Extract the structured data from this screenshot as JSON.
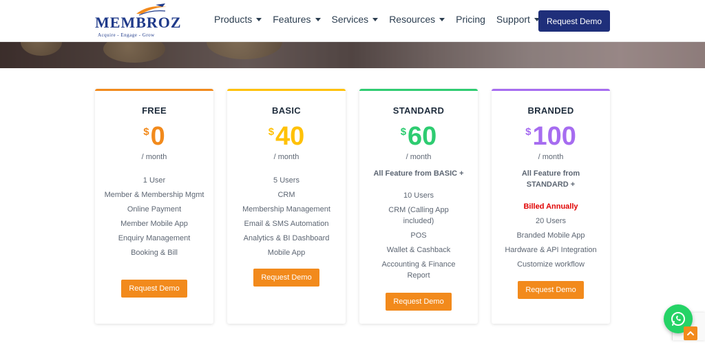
{
  "logo": {
    "word": "MEMBROZ",
    "tagline": "Acquire - Engage - Grow"
  },
  "nav": [
    {
      "label": "Products",
      "dropdown": true
    },
    {
      "label": "Features",
      "dropdown": true
    },
    {
      "label": "Services",
      "dropdown": true
    },
    {
      "label": "Resources",
      "dropdown": true
    },
    {
      "label": "Pricing",
      "dropdown": false
    },
    {
      "label": "Support",
      "dropdown": true
    }
  ],
  "header_button": "Request Demo",
  "colors": {
    "free": "#f28a1c",
    "basic": "#ffc107",
    "standard": "#2ecc71",
    "branded": "#a66cf0",
    "cta": "#f28a1c",
    "header_button": "#1f2f7a",
    "billed": "#e00000"
  },
  "plans": [
    {
      "name": "FREE",
      "currency": "$",
      "amount": "0",
      "period": "/ month",
      "note": "",
      "billed": "",
      "features": [
        "1 User",
        "Member & Membership Mgmt",
        "Online Payment",
        "Member Mobile App",
        "Enquiry Management",
        "Booking & Bill"
      ],
      "cta": "Request Demo"
    },
    {
      "name": "BASIC",
      "currency": "$",
      "amount": "40",
      "period": "/ month",
      "note": "",
      "billed": "",
      "features": [
        "5 Users",
        "CRM",
        "Membership Management",
        "Email & SMS Automation",
        "Analytics & BI Dashboard",
        "Mobile App"
      ],
      "cta": "Request Demo"
    },
    {
      "name": "STANDARD",
      "currency": "$",
      "amount": "60",
      "period": "/ month",
      "note": "All Feature from BASIC +",
      "billed": "",
      "features": [
        "10 Users",
        "CRM (Calling App included)",
        "POS",
        "Wallet & Cashback",
        "Accounting & Finance Report"
      ],
      "cta": "Request Demo"
    },
    {
      "name": "BRANDED",
      "currency": "$",
      "amount": "100",
      "period": "/ month",
      "note": "All Feature from STANDARD +",
      "billed": "Billed Annually",
      "features": [
        "20 Users",
        "Branded Mobile App",
        "Hardware & API Integration",
        "Customize workflow"
      ],
      "cta": "Request Demo"
    }
  ],
  "icons": {
    "whatsapp": "whatsapp-icon",
    "scroll_top": "chevron-up-icon"
  }
}
